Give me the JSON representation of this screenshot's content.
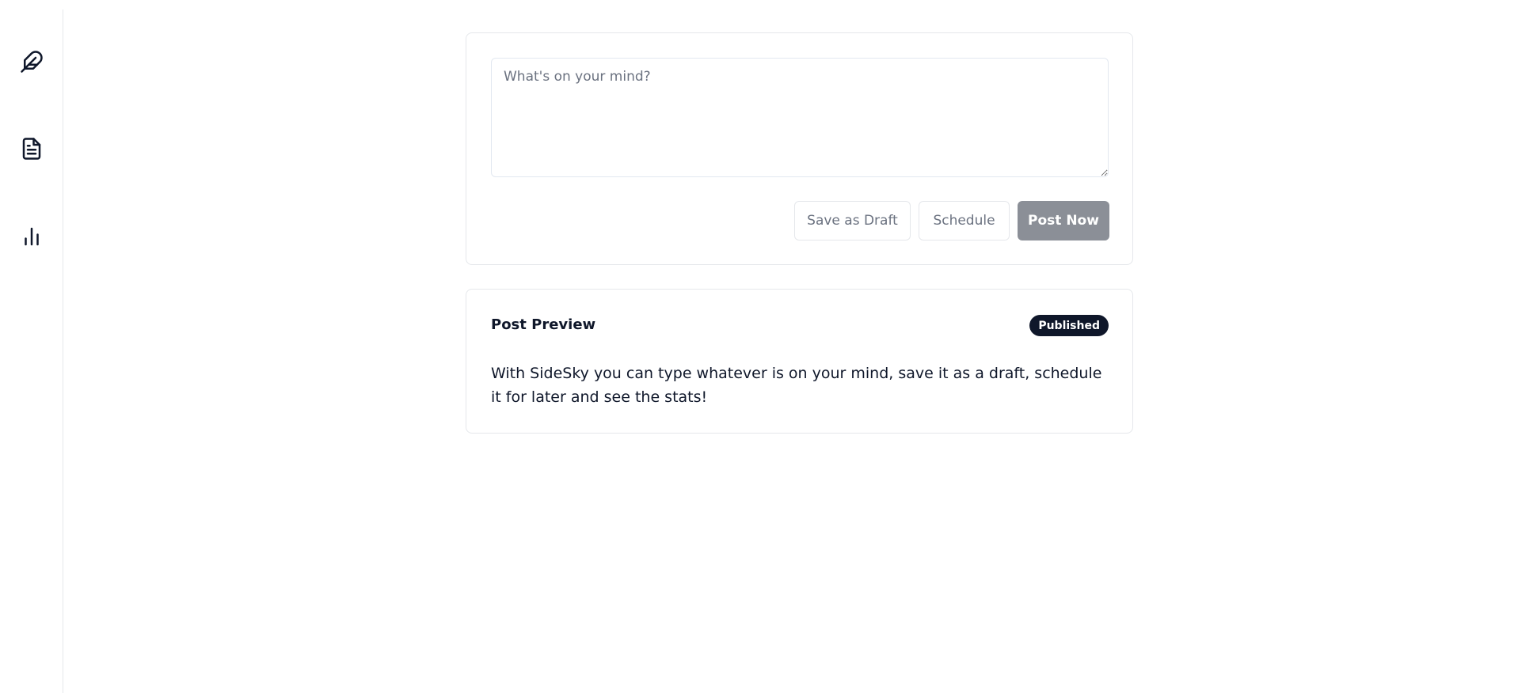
{
  "sidebar": {
    "items": [
      {
        "icon": "feather-icon",
        "label": ""
      },
      {
        "icon": "document-icon",
        "label": ""
      },
      {
        "icon": "bar-chart-icon",
        "label": ""
      }
    ]
  },
  "composer": {
    "placeholder": "What's on your mind?",
    "value": "",
    "buttons": {
      "draft": "Save as Draft",
      "schedule": "Schedule",
      "post": "Post Now"
    }
  },
  "preview": {
    "title": "Post Preview",
    "status": "Published",
    "body": "With SideSky you can type whatever is on your mind, save it as a draft, schedule it for later and see the stats!"
  },
  "colors": {
    "text": "#0f172a",
    "badge_bg": "#0f172a",
    "post_button_bg": "#8b8f97",
    "border": "#e5e7eb"
  }
}
